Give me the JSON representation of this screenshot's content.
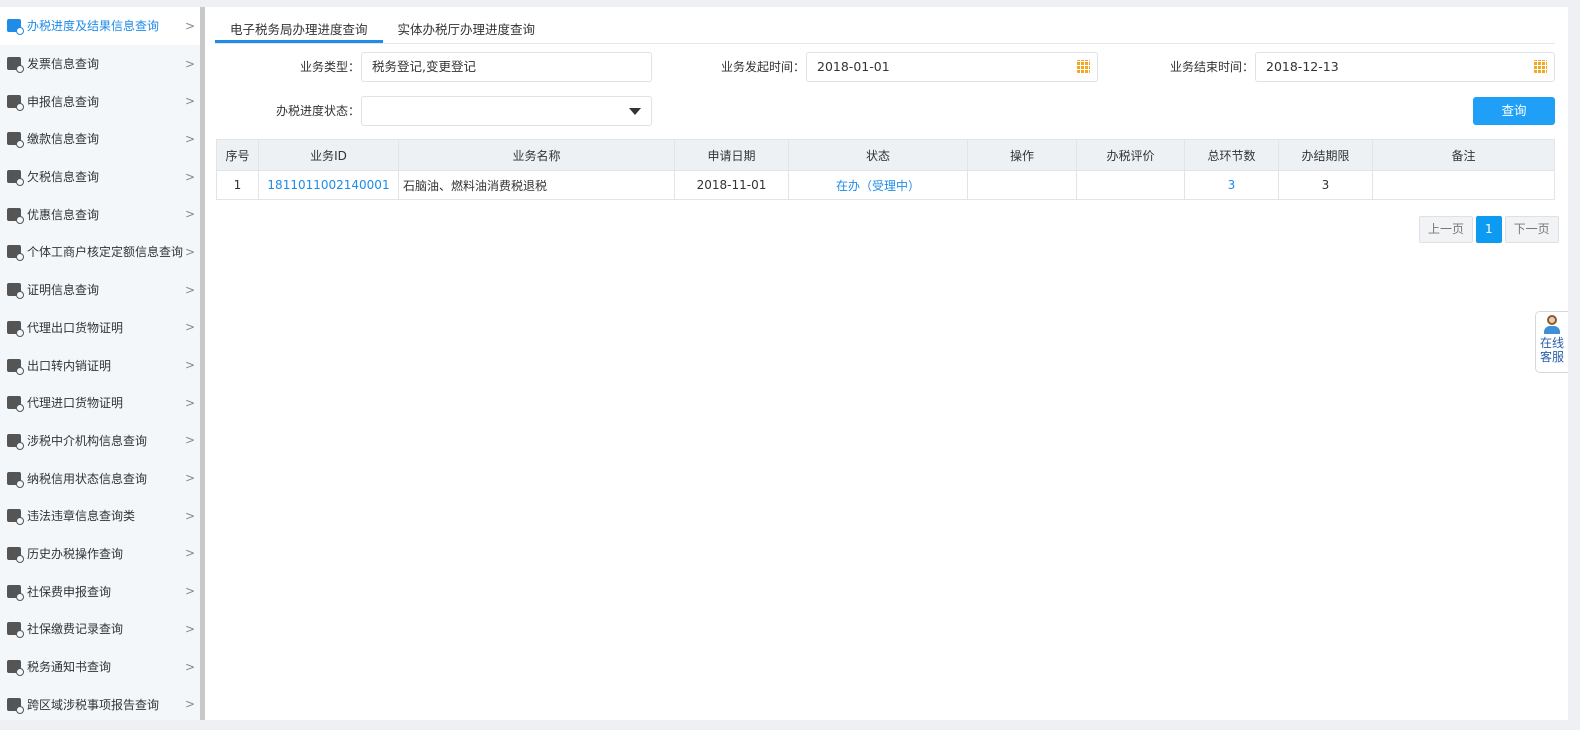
{
  "sidebar": {
    "items": [
      {
        "label": "办税进度及结果信息查询",
        "active": true
      },
      {
        "label": "发票信息查询"
      },
      {
        "label": "申报信息查询"
      },
      {
        "label": "缴款信息查询"
      },
      {
        "label": "欠税信息查询"
      },
      {
        "label": "优惠信息查询"
      },
      {
        "label": "个体工商户核定定额信息查询"
      },
      {
        "label": "证明信息查询"
      },
      {
        "label": "代理出口货物证明"
      },
      {
        "label": "出口转内销证明"
      },
      {
        "label": "代理进口货物证明"
      },
      {
        "label": "涉税中介机构信息查询"
      },
      {
        "label": "纳税信用状态信息查询"
      },
      {
        "label": "违法违章信息查询类"
      },
      {
        "label": "历史办税操作查询"
      },
      {
        "label": "社保费申报查询"
      },
      {
        "label": "社保缴费记录查询"
      },
      {
        "label": "税务通知书查询"
      },
      {
        "label": "跨区域涉税事项报告查询"
      }
    ]
  },
  "tabs": [
    {
      "label": "电子税务局办理进度查询",
      "active": true
    },
    {
      "label": "实体办税厅办理进度查询"
    }
  ],
  "form": {
    "biz_type_label": "业务类型：",
    "biz_type_value": "税务登记,变更登记",
    "start_label": "业务发起时间：",
    "start_value": "2018-01-01",
    "end_label": "业务结束时间：",
    "end_value": "2018-12-13",
    "status_label": "办税进度状态：",
    "status_value": "",
    "query_label": "查询"
  },
  "table": {
    "headers": [
      "序号",
      "业务ID",
      "业务名称",
      "申请日期",
      "状态",
      "操作",
      "办税评价",
      "总环节数",
      "办结期限",
      "备注"
    ],
    "rows": [
      [
        "1",
        "1811011002140001",
        "石脑油、燃料油消费税退税",
        "2018-11-01",
        "在办（受理中）",
        "",
        "",
        "3",
        "3",
        ""
      ]
    ]
  },
  "pager": {
    "prev": "上一页",
    "current": "1",
    "next": "下一页"
  },
  "chat": {
    "line1": "在线",
    "line2": "客服"
  },
  "colors": {
    "accent": "#1f8ce8",
    "button": "#1f9ff5",
    "calendar": "#f5a623"
  }
}
